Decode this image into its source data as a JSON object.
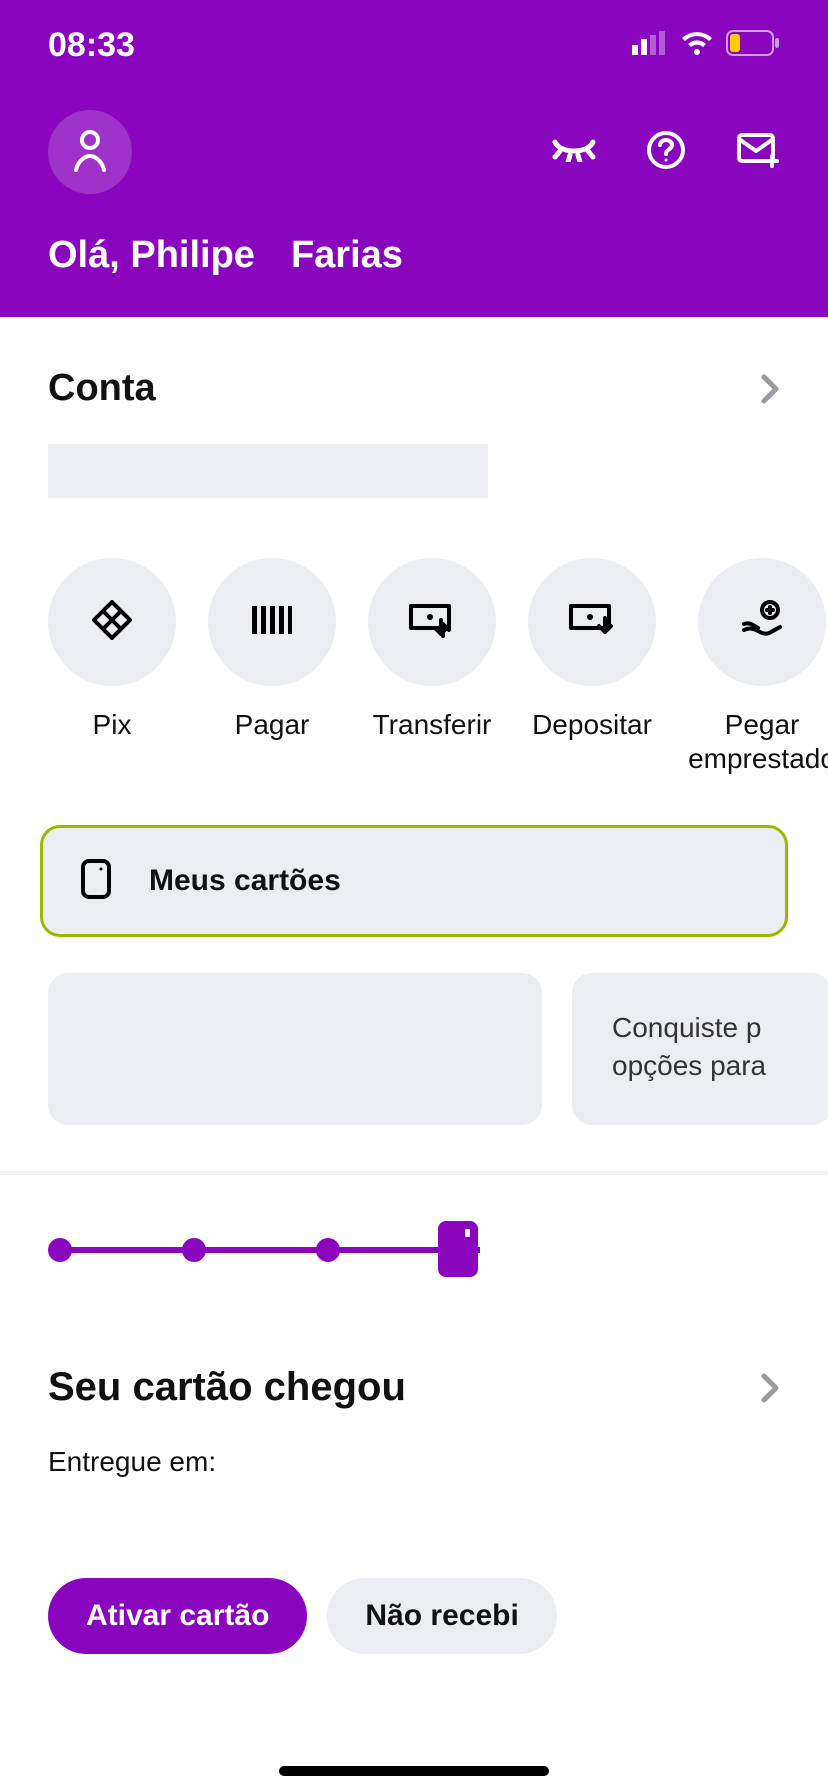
{
  "status": {
    "time": "08:33"
  },
  "greeting": {
    "hello": "Olá, Philipe",
    "surname": "Farias"
  },
  "account": {
    "title": "Conta"
  },
  "actions": {
    "pix": "Pix",
    "pagar": "Pagar",
    "transferir": "Transferir",
    "depositar": "Depositar",
    "pegar": "Pegar emprestado"
  },
  "cards_button": {
    "label": "Meus cartões"
  },
  "promo": {
    "b_text": "Conquiste p\nopções para"
  },
  "card_delivery": {
    "title": "Seu cartão chegou",
    "delivered_label": "Entregue em:",
    "activate": "Ativar cartão",
    "not_received": "Não recebi"
  }
}
